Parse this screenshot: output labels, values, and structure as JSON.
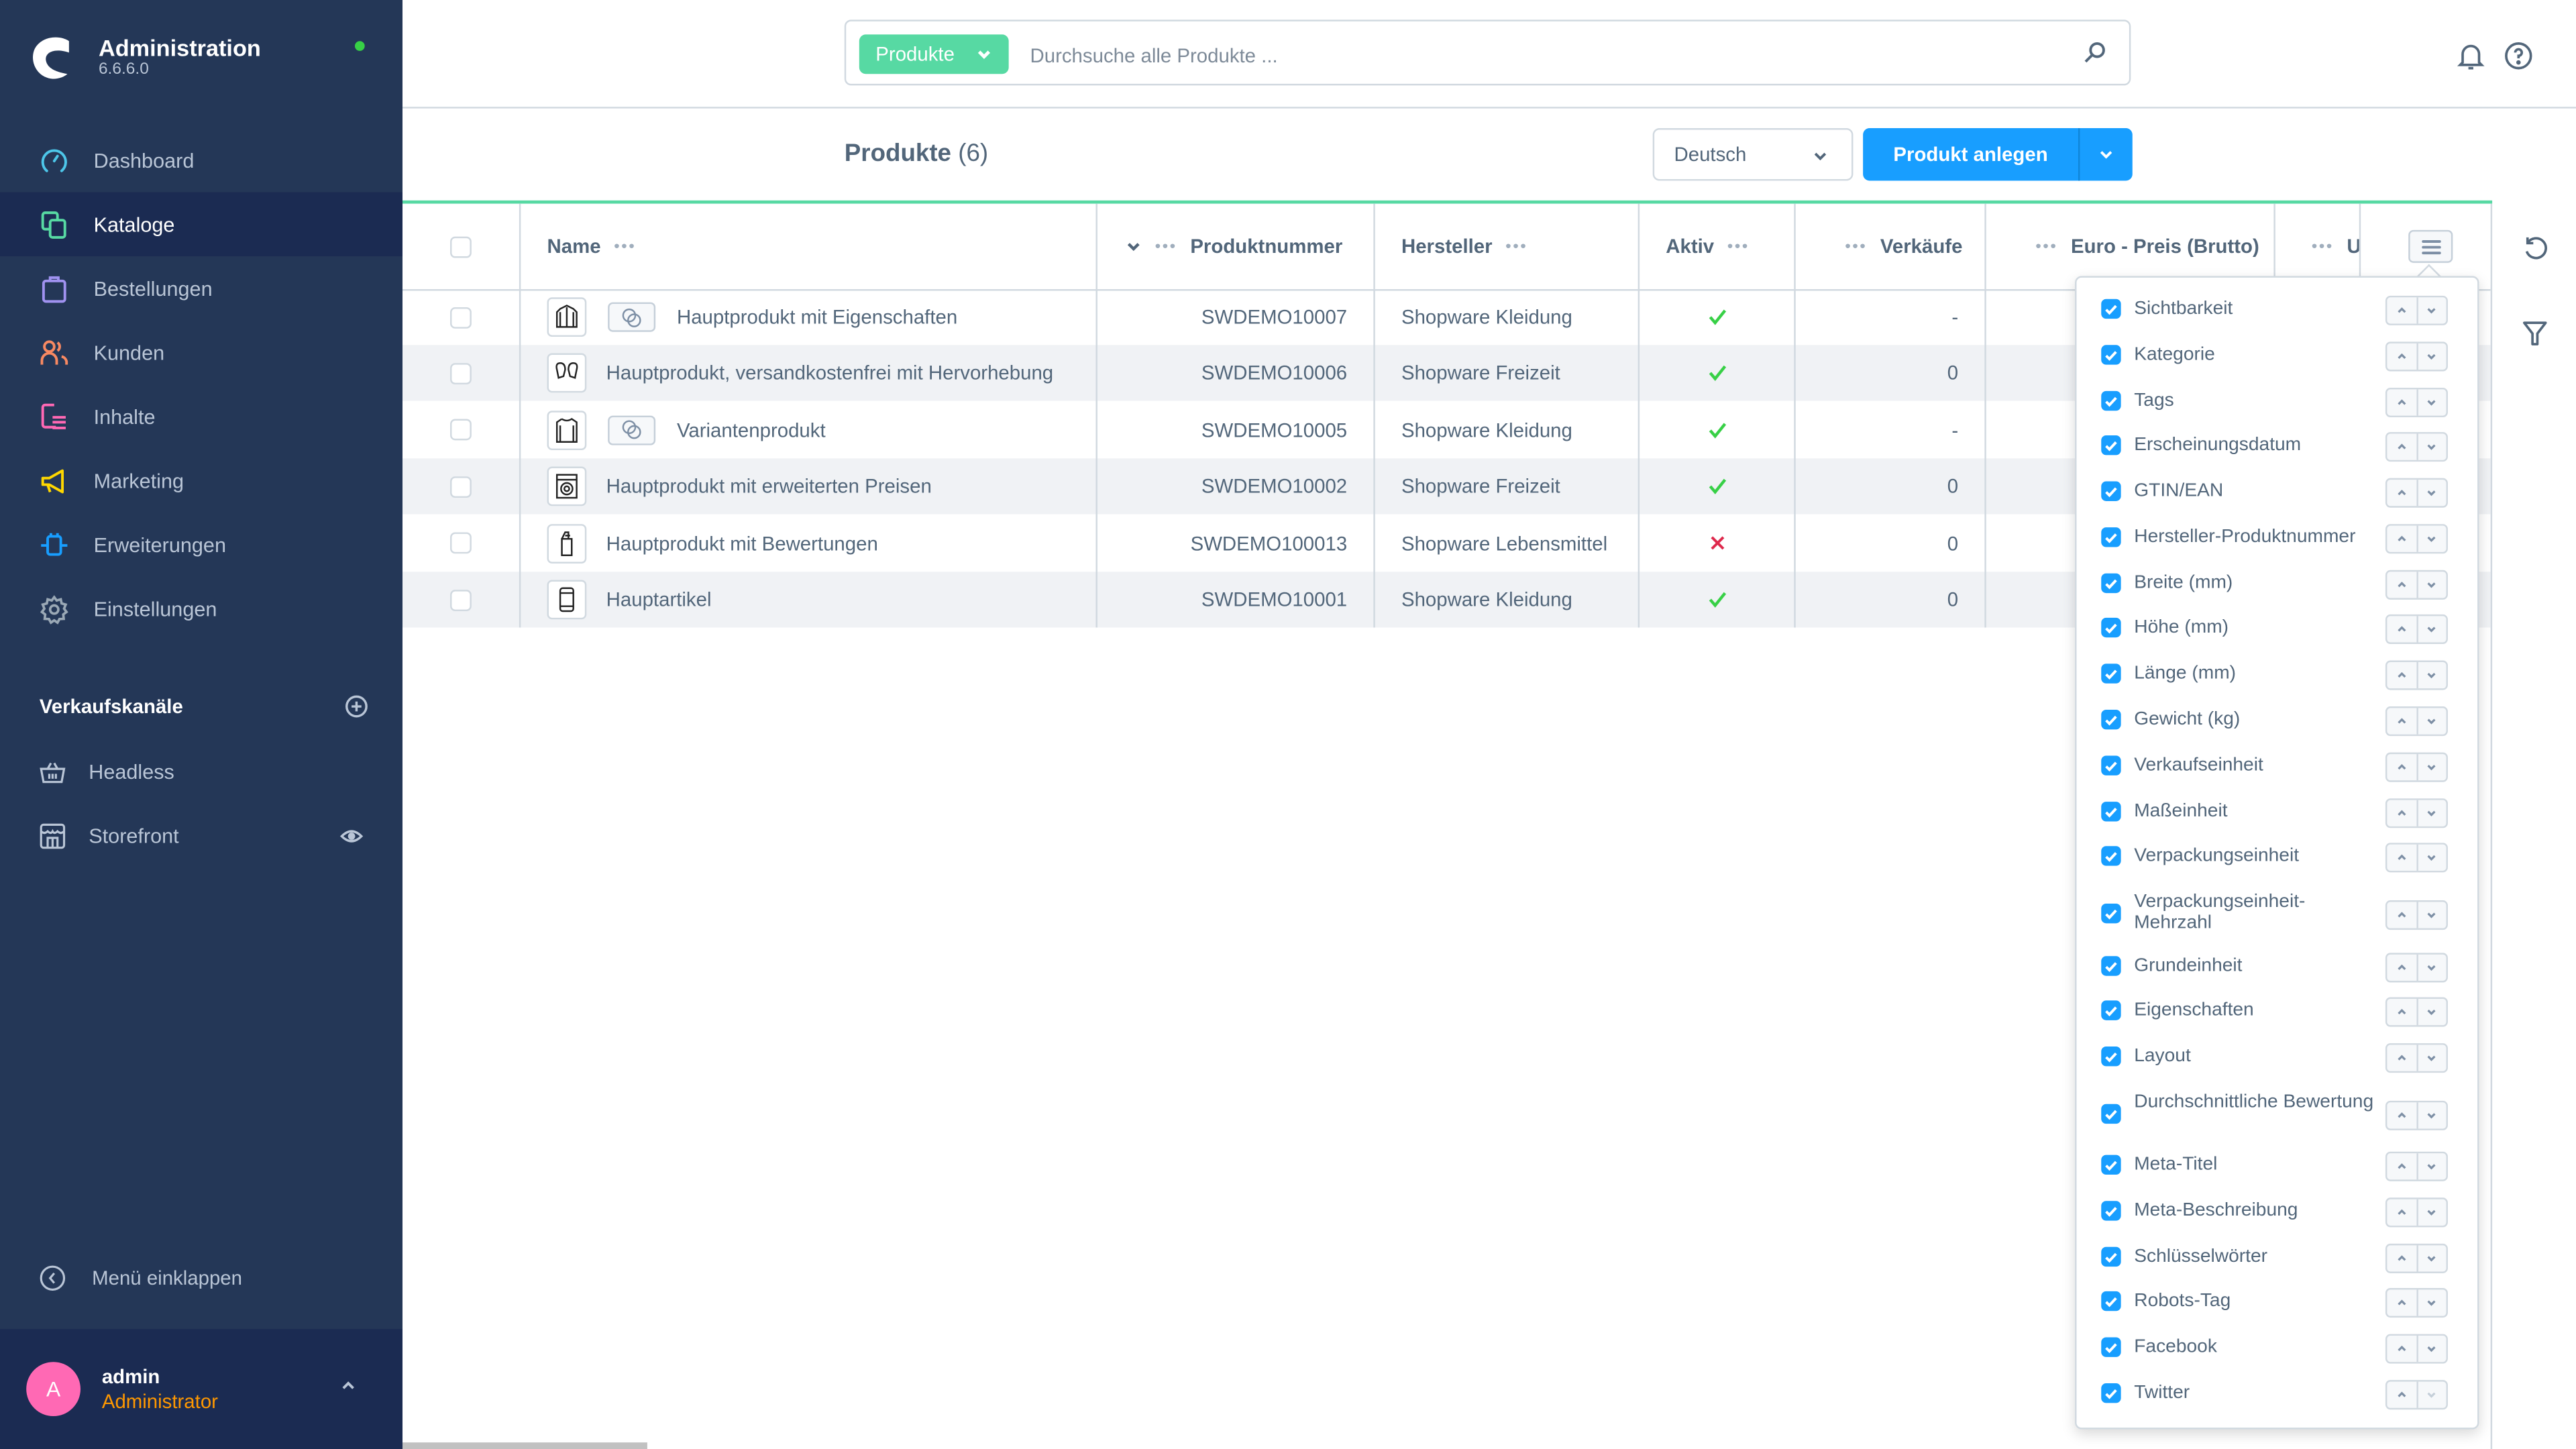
{
  "app": {
    "title": "Administration",
    "version": "6.6.6.0",
    "status_color": "#37d046"
  },
  "sidebar": {
    "items": [
      {
        "label": "Dashboard",
        "icon": "dashboard-icon",
        "color": "#4dc6e9"
      },
      {
        "label": "Kataloge",
        "icon": "catalog-icon",
        "color": "#57d9a3",
        "active": true
      },
      {
        "label": "Bestellungen",
        "icon": "shopping-bag-icon",
        "color": "#a092f0"
      },
      {
        "label": "Kunden",
        "icon": "customers-icon",
        "color": "#f88962"
      },
      {
        "label": "Inhalte",
        "icon": "content-icon",
        "color": "#ff68b4"
      },
      {
        "label": "Marketing",
        "icon": "megaphone-icon",
        "color": "#ffd700"
      },
      {
        "label": "Erweiterungen",
        "icon": "plug-icon",
        "color": "#189eff"
      },
      {
        "label": "Einstellungen",
        "icon": "gear-icon",
        "color": "#9aa8b5"
      }
    ],
    "sales_channels_title": "Verkaufskanäle",
    "sales_channels": [
      {
        "label": "Headless",
        "icon": "basket-icon"
      },
      {
        "label": "Storefront",
        "icon": "storefront-icon"
      }
    ],
    "collapse_label": "Menü einklappen",
    "user": {
      "initial": "A",
      "name": "admin",
      "role": "Administrator"
    }
  },
  "search": {
    "type_label": "Produkte",
    "placeholder": "Durchsuche alle Produkte ...",
    "value": ""
  },
  "smartbar": {
    "title": "Produkte",
    "count": "(6)",
    "language": "Deutsch",
    "create_label": "Produkt anlegen"
  },
  "grid": {
    "columns": [
      "Name",
      "Produktnummer",
      "Hersteller",
      "Aktiv",
      "Verkäufe",
      "Euro - Preis (Brutto)",
      "US"
    ],
    "rows": [
      {
        "name": "Hauptprodukt mit Eigenschaften",
        "number": "SWDEMO10007",
        "manufacturer": "Shopware Kleidung",
        "active": true,
        "sales": "-",
        "variant": true,
        "thumb": "jacket-icon"
      },
      {
        "name": "Hauptprodukt, versandkostenfrei mit Hervorhebung",
        "number": "SWDEMO10006",
        "manufacturer": "Shopware Freizeit",
        "active": true,
        "sales": "0",
        "variant": false,
        "thumb": "mittens-icon"
      },
      {
        "name": "Variantenprodukt",
        "number": "SWDEMO10005",
        "manufacturer": "Shopware Kleidung",
        "active": true,
        "sales": "-",
        "variant": true,
        "thumb": "sweater-icon"
      },
      {
        "name": "Hauptprodukt mit erweiterten Preisen",
        "number": "SWDEMO10002",
        "manufacturer": "Shopware Freizeit",
        "active": true,
        "sales": "0",
        "variant": false,
        "thumb": "washing-machine-icon"
      },
      {
        "name": "Hauptprodukt mit Bewertungen",
        "number": "SWDEMO100013",
        "manufacturer": "Shopware Lebensmittel",
        "active": false,
        "sales": "0",
        "variant": false,
        "thumb": "chocolate-icon"
      },
      {
        "name": "Hauptartikel",
        "number": "SWDEMO10001",
        "manufacturer": "Shopware Kleidung",
        "active": true,
        "sales": "0",
        "variant": false,
        "thumb": "phone-icon"
      }
    ]
  },
  "column_settings": {
    "options": [
      {
        "label": "Sichtbarkeit",
        "checked": true
      },
      {
        "label": "Kategorie",
        "checked": true
      },
      {
        "label": "Tags",
        "checked": true
      },
      {
        "label": "Erscheinungsdatum",
        "checked": true
      },
      {
        "label": "GTIN/EAN",
        "checked": true
      },
      {
        "label": "Hersteller-Produktnummer",
        "checked": true
      },
      {
        "label": "Breite (mm)",
        "checked": true
      },
      {
        "label": "Höhe (mm)",
        "checked": true
      },
      {
        "label": "Länge (mm)",
        "checked": true
      },
      {
        "label": "Gewicht (kg)",
        "checked": true
      },
      {
        "label": "Verkaufseinheit",
        "checked": true
      },
      {
        "label": "Maßeinheit",
        "checked": true
      },
      {
        "label": "Verpackungseinheit",
        "checked": true
      },
      {
        "label": "Verpackungseinheit-Mehrzahl",
        "checked": true
      },
      {
        "label": "Grundeinheit",
        "checked": true
      },
      {
        "label": "Eigenschaften",
        "checked": true
      },
      {
        "label": "Layout",
        "checked": true
      },
      {
        "label": "Durchschnittliche Bewertung",
        "checked": true
      },
      {
        "label": "Meta-Titel",
        "checked": true
      },
      {
        "label": "Meta-Beschreibung",
        "checked": true
      },
      {
        "label": "Schlüsselwörter",
        "checked": true
      },
      {
        "label": "Robots-Tag",
        "checked": true
      },
      {
        "label": "Facebook",
        "checked": true
      },
      {
        "label": "Twitter",
        "checked": true
      }
    ]
  },
  "colors": {
    "sidebar_bg": "#243757",
    "sidebar_active": "#1b2b52",
    "primary": "#189eff",
    "accent_green": "#57d9a3",
    "active_check": "#37d046",
    "inactive_cross": "#de294c",
    "role_color": "#ff9800",
    "avatar_bg": "#ff69b4"
  }
}
